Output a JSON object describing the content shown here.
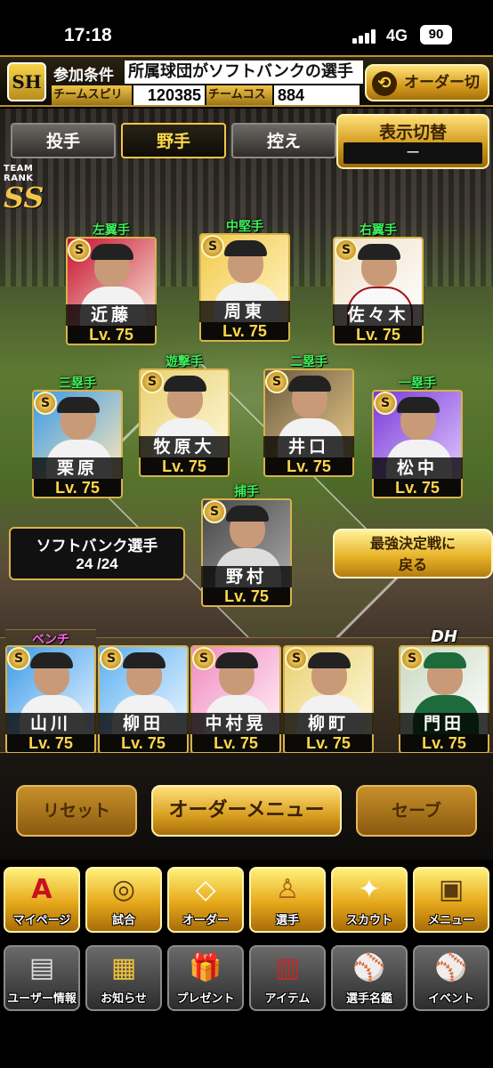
{
  "status_bar": {
    "time": "17:18",
    "network": "4G",
    "battery": "90"
  },
  "header": {
    "team_logo": "SH",
    "condition_label": "参加条件",
    "condition_text": "所属球団がソフトバンクの選手",
    "spirit_label": "チームスピリッツ",
    "spirit_value": "120385",
    "cost_label": "チームコスト",
    "cost_value": "884",
    "order_switch_label": "オーダー切替",
    "order_switch_icon": "swap-arrows-icon"
  },
  "tabs": [
    {
      "label": "投手",
      "active": false
    },
    {
      "label": "野手",
      "active": true
    },
    {
      "label": "控え",
      "active": false
    }
  ],
  "display_toggle": {
    "label": "表示切替",
    "value": "ー"
  },
  "team_rank": {
    "label": "TEAM RANK",
    "value": "SS"
  },
  "players": [
    {
      "position": "左翼手",
      "name": "近藤",
      "level": "Lv. 75",
      "badge": "S"
    },
    {
      "position": "中堅手",
      "name": "周東",
      "level": "Lv. 75",
      "badge": "S"
    },
    {
      "position": "右翼手",
      "name": "佐々木",
      "level": "Lv. 75",
      "badge": "S"
    },
    {
      "position": "三塁手",
      "name": "栗原",
      "level": "Lv. 75",
      "badge": "S"
    },
    {
      "position": "遊撃手",
      "name": "牧原大",
      "level": "Lv. 75",
      "badge": "S"
    },
    {
      "position": "二塁手",
      "name": "井口",
      "level": "Lv. 75",
      "badge": "S"
    },
    {
      "position": "一塁手",
      "name": "松中",
      "level": "Lv. 75",
      "badge": "S"
    },
    {
      "position": "捕手",
      "name": "野村",
      "level": "Lv. 75",
      "badge": "S"
    }
  ],
  "team_count": {
    "label": "ソフトバンク選手",
    "value": "24 /24"
  },
  "return_button": {
    "line1": "最強決定戦に",
    "line2": "戻る"
  },
  "bench_label": "ベンチ",
  "bench": [
    {
      "name": "山川",
      "level": "Lv. 75",
      "badge": "S"
    },
    {
      "name": "柳田",
      "level": "Lv. 75",
      "badge": "S"
    },
    {
      "name": "中村晃",
      "level": "Lv. 75",
      "badge": "S"
    },
    {
      "name": "柳町",
      "level": "Lv. 75",
      "badge": "S"
    }
  ],
  "dh": {
    "position": "DH",
    "name": "門田",
    "level": "Lv. 75",
    "badge": "S"
  },
  "actions": {
    "reset": "リセット",
    "order_menu": "オーダーメニュー",
    "save": "セーブ"
  },
  "nav_row1": [
    {
      "label": "マイページ",
      "icon": "mypage-a-icon",
      "glyph": "A"
    },
    {
      "label": "試合",
      "icon": "stadium-icon",
      "glyph": "◎"
    },
    {
      "label": "オーダー",
      "icon": "order-field-icon",
      "glyph": "◇"
    },
    {
      "label": "選手",
      "icon": "player-icon",
      "glyph": "♙"
    },
    {
      "label": "スカウト",
      "icon": "scout-card-icon",
      "glyph": "✦"
    },
    {
      "label": "メニュー",
      "icon": "menu-box-icon",
      "glyph": "▣"
    }
  ],
  "nav_row2": [
    {
      "label": "ユーザー情報",
      "icon": "user-card-icon",
      "glyph": "▤"
    },
    {
      "label": "お知らせ",
      "icon": "notice-box-icon",
      "glyph": "▦"
    },
    {
      "label": "プレゼント",
      "icon": "gift-icon",
      "glyph": "🎁"
    },
    {
      "label": "アイテム",
      "icon": "item-book-icon",
      "glyph": "▥"
    },
    {
      "label": "選手名鑑",
      "icon": "directory-icon",
      "glyph": "⚾"
    },
    {
      "label": "イベント",
      "icon": "event-bat-ball-icon",
      "glyph": "⚾"
    }
  ]
}
